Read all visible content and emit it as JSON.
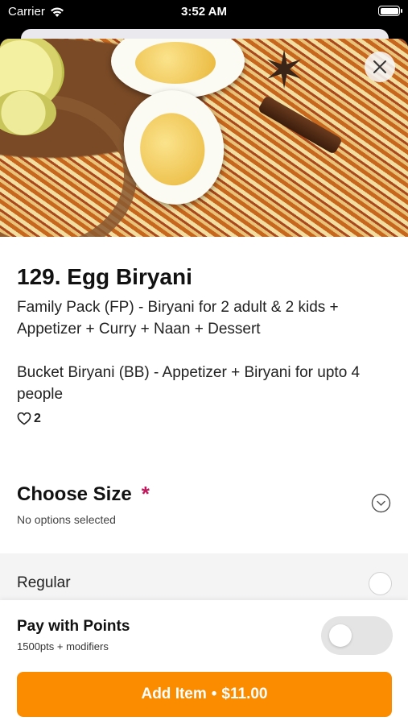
{
  "status_bar": {
    "carrier": "Carrier",
    "time": "3:52 AM",
    "icons": [
      "wifi-icon",
      "battery-icon"
    ]
  },
  "hero": {
    "icons": [
      "close-icon"
    ]
  },
  "item": {
    "title": "129. Egg Biryani",
    "description_1": "Family Pack (FP) - Biryani for 2 adult & 2 kids + Appetizer + Curry + Naan + Dessert",
    "description_2": "Bucket Biryani (BB) - Appetizer + Biryani for upto 4 people",
    "likes": "2"
  },
  "size_section": {
    "title": "Choose Size",
    "required_mark": "*",
    "subtitle": "No options selected",
    "options": [
      {
        "label": "Regular",
        "selected": false
      }
    ]
  },
  "footer": {
    "pay_title": "Pay with Points",
    "pay_subtitle": "1500pts + modifiers",
    "pay_toggle_on": false,
    "add_label": "Add Item",
    "separator": "•",
    "price": "$11.00"
  },
  "colors": {
    "accent": "#fb8c00",
    "required": "#c2185b",
    "toggle_off": "#e4e4e4"
  }
}
